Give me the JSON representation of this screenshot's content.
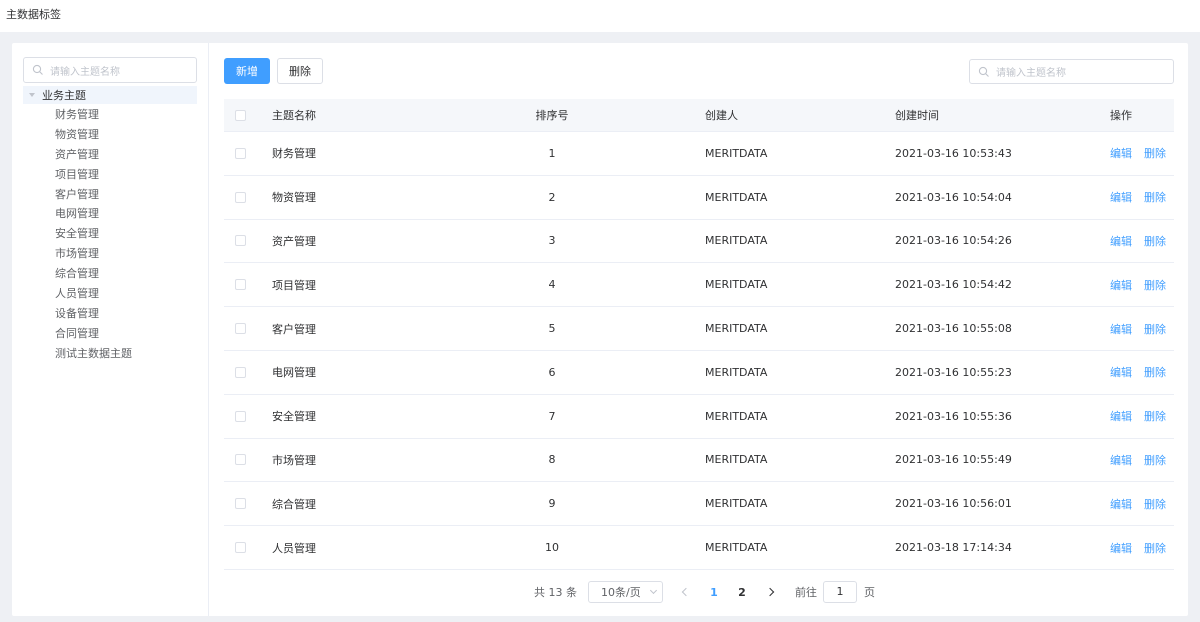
{
  "header": {
    "title": "主数据标签"
  },
  "sidebar": {
    "search_placeholder": "请输入主题名称",
    "root_label": "业务主题",
    "items": [
      "财务管理",
      "物资管理",
      "资产管理",
      "项目管理",
      "客户管理",
      "电网管理",
      "安全管理",
      "市场管理",
      "综合管理",
      "人员管理",
      "设备管理",
      "合同管理",
      "测试主数据主题"
    ]
  },
  "toolbar": {
    "add_label": "新增",
    "delete_label": "删除",
    "search_placeholder": "请输入主题名称"
  },
  "table": {
    "headers": {
      "name": "主题名称",
      "order": "排序号",
      "creator": "创建人",
      "time": "创建时间",
      "ops": "操作"
    },
    "rows": [
      {
        "name": "财务管理",
        "order": "1",
        "creator": "MERITDATA",
        "time": "2021-03-16 10:53:43"
      },
      {
        "name": "物资管理",
        "order": "2",
        "creator": "MERITDATA",
        "time": "2021-03-16 10:54:04"
      },
      {
        "name": "资产管理",
        "order": "3",
        "creator": "MERITDATA",
        "time": "2021-03-16 10:54:26"
      },
      {
        "name": "项目管理",
        "order": "4",
        "creator": "MERITDATA",
        "time": "2021-03-16 10:54:42"
      },
      {
        "name": "客户管理",
        "order": "5",
        "creator": "MERITDATA",
        "time": "2021-03-16 10:55:08"
      },
      {
        "name": "电网管理",
        "order": "6",
        "creator": "MERITDATA",
        "time": "2021-03-16 10:55:23"
      },
      {
        "name": "安全管理",
        "order": "7",
        "creator": "MERITDATA",
        "time": "2021-03-16 10:55:36"
      },
      {
        "name": "市场管理",
        "order": "8",
        "creator": "MERITDATA",
        "time": "2021-03-16 10:55:49"
      },
      {
        "name": "综合管理",
        "order": "9",
        "creator": "MERITDATA",
        "time": "2021-03-16 10:56:01"
      },
      {
        "name": "人员管理",
        "order": "10",
        "creator": "MERITDATA",
        "time": "2021-03-18 17:14:34"
      }
    ],
    "edit_label": "编辑",
    "delete_label": "删除"
  },
  "pagination": {
    "total_text": "共 13 条",
    "page_size": "10条/页",
    "pages": [
      "1",
      "2"
    ],
    "current_page": "1",
    "goto_prefix": "前往",
    "goto_value": "1",
    "goto_suffix": "页"
  },
  "colors": {
    "primary": "#409eff",
    "text": "#303133",
    "muted": "#c0c4cc"
  },
  "icons": {
    "search": "search-icon",
    "tree_toggle": "caret-down-icon",
    "prev": "chevron-left-icon",
    "next": "chevron-right-icon",
    "select": "chevron-down-icon"
  }
}
